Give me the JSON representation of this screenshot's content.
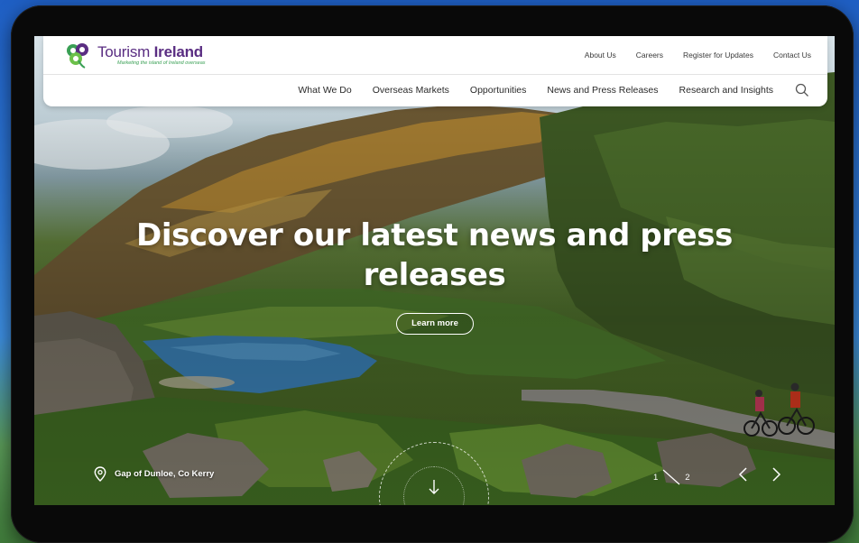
{
  "brand": {
    "name_light": "Tourism ",
    "name_bold": "Ireland",
    "tagline": "Marketing the island of Ireland overseas"
  },
  "utility_nav": [
    {
      "label": "About Us"
    },
    {
      "label": "Careers"
    },
    {
      "label": "Register for Updates"
    },
    {
      "label": "Contact Us"
    }
  ],
  "main_nav": [
    {
      "label": "What We Do"
    },
    {
      "label": "Overseas Markets"
    },
    {
      "label": "Opportunities"
    },
    {
      "label": "News and Press Releases"
    },
    {
      "label": "Research and Insights"
    }
  ],
  "hero": {
    "headline_line1": "Discover our latest news and press",
    "headline_line2": "releases",
    "cta_label": "Learn more",
    "location": "Gap of Dunloe, Co Kerry"
  },
  "slider": {
    "current": "1",
    "total": "2"
  },
  "icons": [
    "shamrock-logo-icon",
    "search-icon",
    "location-pin-icon",
    "arrow-down-icon",
    "chevron-left-icon",
    "chevron-right-icon"
  ],
  "colors": {
    "brand_purple": "#5a2d82",
    "brand_green": "#3aa055",
    "header_bg": "#ffffff",
    "device_frame": "#090909"
  }
}
